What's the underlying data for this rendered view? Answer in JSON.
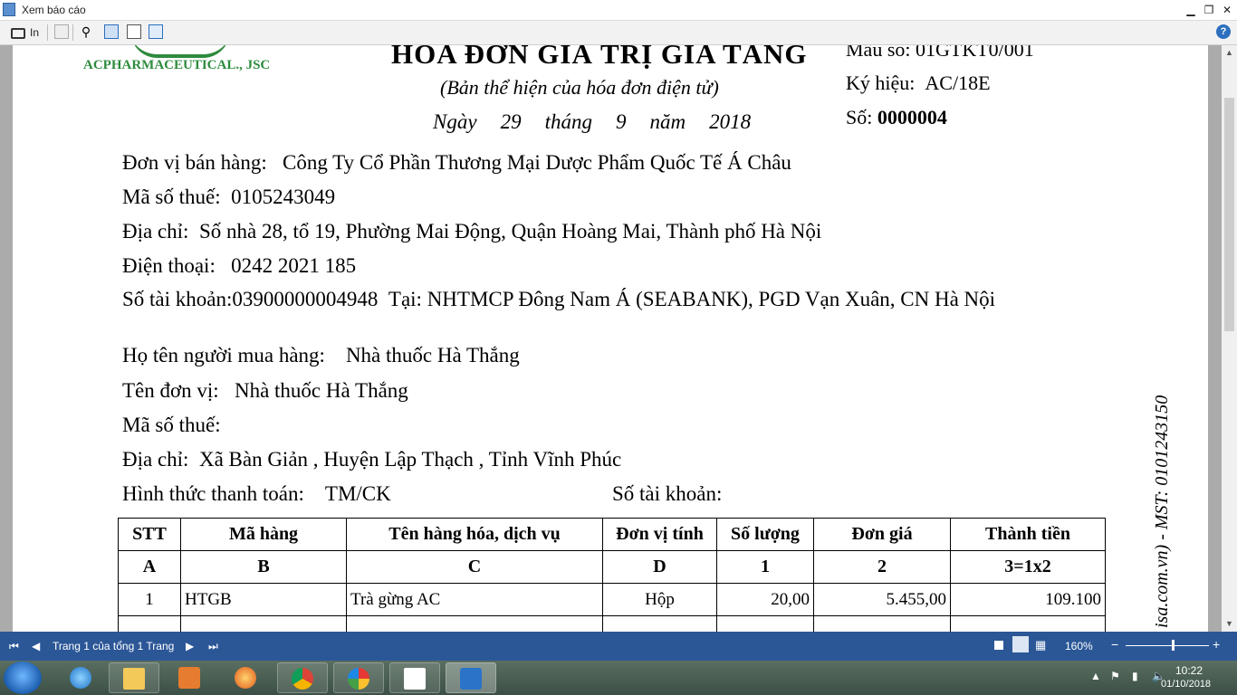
{
  "window": {
    "title": "Xem báo cáo"
  },
  "toolbar": {
    "print_label": "In"
  },
  "invoice": {
    "company_logo_text": "ACPHARMACEUTICAL., JSC",
    "title": "HÓA ĐƠN GIÁ TRỊ GIA TĂNG",
    "subtitle": "(Bản thể hiện của hóa đơn điện tử)",
    "date": {
      "day_label": "Ngày",
      "day": "29",
      "month_label": "tháng",
      "month": "9",
      "year_label": "năm",
      "year": "2018"
    },
    "form_no": "Mẫu số: 01GTKT0/001",
    "symbol_label": "Ký hiệu:",
    "symbol": "AC/18E",
    "number_label": "Số:",
    "number": "0000004",
    "seller": {
      "name_label": "Đơn vị bán hàng:",
      "name": "Công Ty Cổ Phần Thương Mại Dược Phẩm Quốc Tế Á Châu",
      "tax_label": "Mã số thuế:",
      "tax": "0105243049",
      "address_label": "Địa chỉ:",
      "address": "Số nhà 28, tổ 19, Phường Mai Động, Quận Hoàng Mai, Thành phố Hà Nội",
      "phone_label": "Điện thoại:",
      "phone": "0242 2021 185",
      "account_label": "Số tài khoản:",
      "account": "03900000004948",
      "bank_label": "Tại:",
      "bank": "NHTMCP Đông Nam Á (SEABANK), PGD Vạn Xuân, CN Hà Nội"
    },
    "buyer": {
      "name_label": "Họ tên người mua hàng:",
      "name": "Nhà thuốc Hà Thắng",
      "unit_label": "Tên đơn vị:",
      "unit": "Nhà thuốc Hà Thắng",
      "tax_label": "Mã số thuế:",
      "address_label": "Địa chỉ:",
      "address": "Xã Bàn Giản , Huyện Lập Thạch , Tỉnh Vĩnh Phúc",
      "payment_label": "Hình thức thanh toán:",
      "payment": "TM/CK",
      "account_label": "Số tài khoản:"
    },
    "side_text": "isa.com.vn) - MST: 0101243150",
    "table": {
      "headers": [
        "STT",
        "Mã hàng",
        "Tên hàng hóa, dịch vụ",
        "Đơn vị tính",
        "Số lượng",
        "Đơn giá",
        "Thành tiền"
      ],
      "codes": [
        "A",
        "B",
        "C",
        "D",
        "1",
        "2",
        "3=1x2"
      ],
      "rows": [
        [
          "1",
          "HTGB",
          "Trà gừng AC",
          "Hộp",
          "20,00",
          "5.455,00",
          "109.100"
        ]
      ]
    }
  },
  "statusbar": {
    "page_info": "Trang 1 của tổng 1 Trang",
    "zoom": "160%"
  },
  "taskbar": {
    "time": "10:22",
    "date": "01/10/2018"
  }
}
